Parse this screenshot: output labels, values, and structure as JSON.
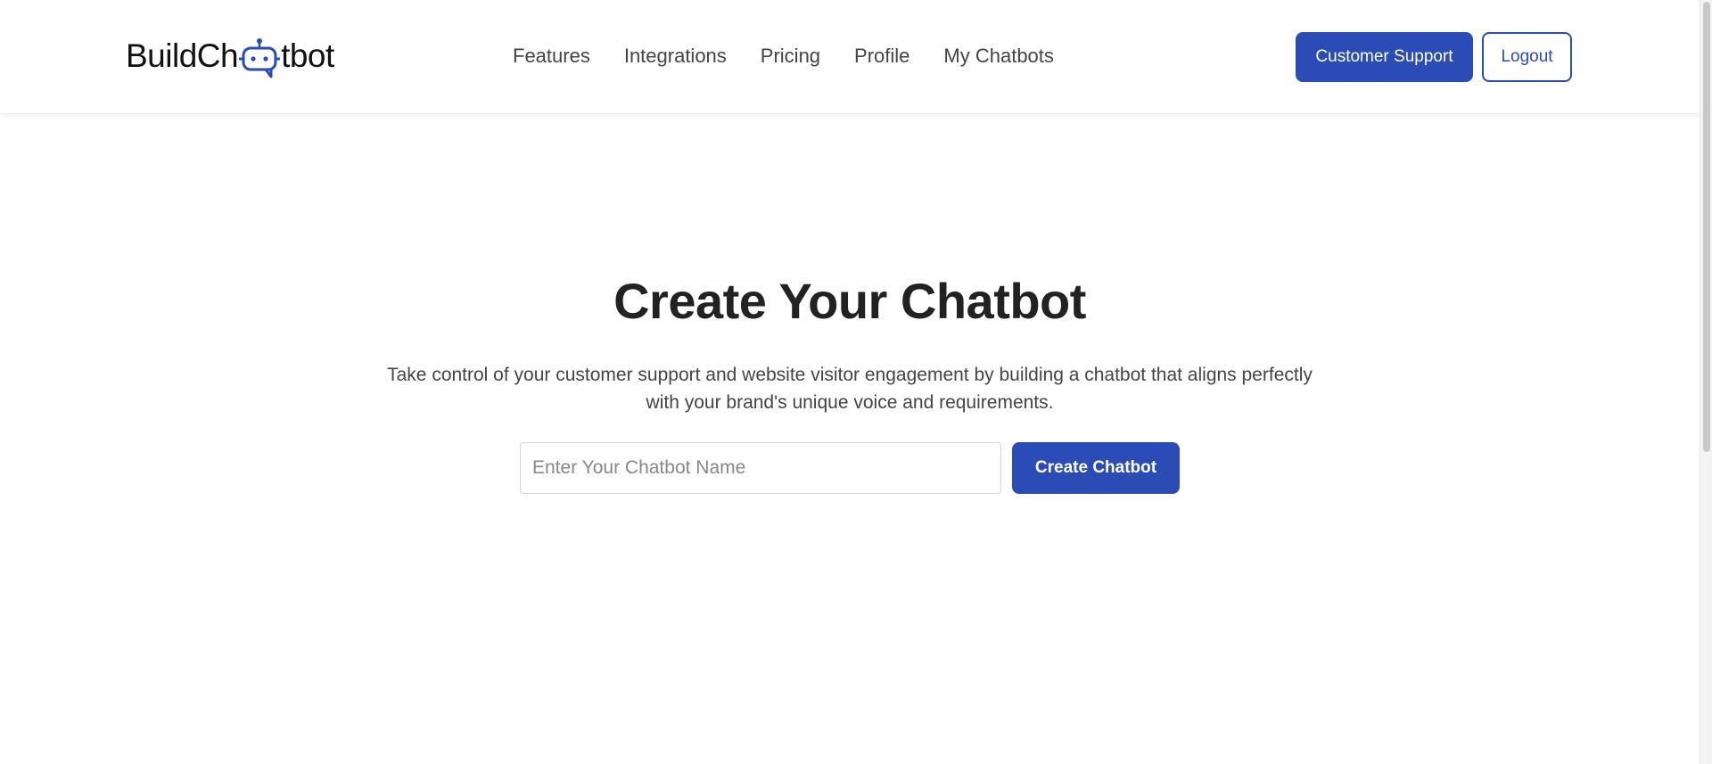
{
  "brand": {
    "logo_prefix": "BuildCh",
    "logo_icon": "chat-bot-icon",
    "logo_suffix": "tbot",
    "accent_color": "#2b4bb5"
  },
  "nav": {
    "items": [
      {
        "label": "Features"
      },
      {
        "label": "Integrations"
      },
      {
        "label": "Pricing"
      },
      {
        "label": "Profile"
      },
      {
        "label": "My Chatbots"
      }
    ]
  },
  "header_actions": {
    "support_label": "Customer Support",
    "logout_label": "Logout"
  },
  "hero": {
    "title": "Create Your Chatbot",
    "description": "Take control of your customer support and website visitor engagement by building a chatbot that aligns perfectly with your brand's unique voice and requirements.",
    "input_placeholder": "Enter Your Chatbot Name",
    "input_value": "",
    "create_label": "Create Chatbot"
  }
}
